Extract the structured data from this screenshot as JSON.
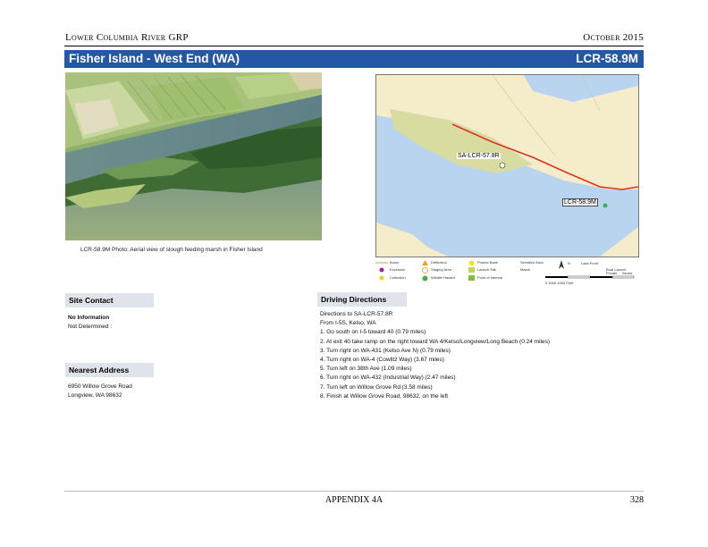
{
  "header": {
    "org": "Lower Columbia River GRP",
    "date": "October 2015"
  },
  "title_bar": {
    "site_name": "Fisher Island - West End (WA)",
    "site_code": "LCR-58.9M"
  },
  "photo": {
    "caption": "LCR-58.9M Photo: Aerial view of slough feeding marsh in Fisher Island"
  },
  "map": {
    "label_sa": "SA-LCR-57.8R",
    "label_site": "LCR-58.9M",
    "colors": {
      "land": "#f5ecc9",
      "water": "#b9d4ee",
      "island": "#d9dca0",
      "road": "#e03020"
    }
  },
  "legend": {
    "items": [
      "Boom",
      "Exclusion",
      "Collection",
      "Deflection",
      "Staging Area",
      "Wildlife Hazard",
      "Protect Bank",
      "Launch Site",
      "Point of Interest",
      "Sensitive Area",
      "Marsh",
      "Lake Front",
      "Boat Launch",
      "Private",
      "Sector"
    ],
    "north": "N",
    "scale": "0  2000  4000 Feet"
  },
  "site_contact": {
    "heading": "Site Contact",
    "line1": "No Information",
    "line2": "Not Determined :"
  },
  "nearest_address": {
    "heading": "Nearest Address",
    "line1": "6950 Willow Grove Road",
    "line2": "Longview, WA 98632"
  },
  "driving_directions": {
    "heading": "Driving Directions",
    "lines": [
      "Directions to SA-LCR-57.8R",
      "From I-5S, Kelso, WA",
      "1. Go south on I-5 toward 40 (0.79 miles)",
      "2. At exit 40 take ramp on the right toward WA 4/Kelso/Longview/Long Beach (0.24 miles)",
      "3. Turn right on WA-431 (Kelso Ave N) (0.79 miles)",
      "4. Turn right on WA-4 (Cowlitz Way) (3.67 miles)",
      "5. Turn left on 38th Ave (1.09 miles)",
      "6. Turn right on WA-432 (Industrial Way) (2.47 miles)",
      "7. Turn left on Willow Grove Rd (3.58 miles)",
      "8. Finish at Willow Grove Road, 98632, on the left"
    ]
  },
  "footer": {
    "appendix": "APPENDIX 4A",
    "page": "328"
  }
}
